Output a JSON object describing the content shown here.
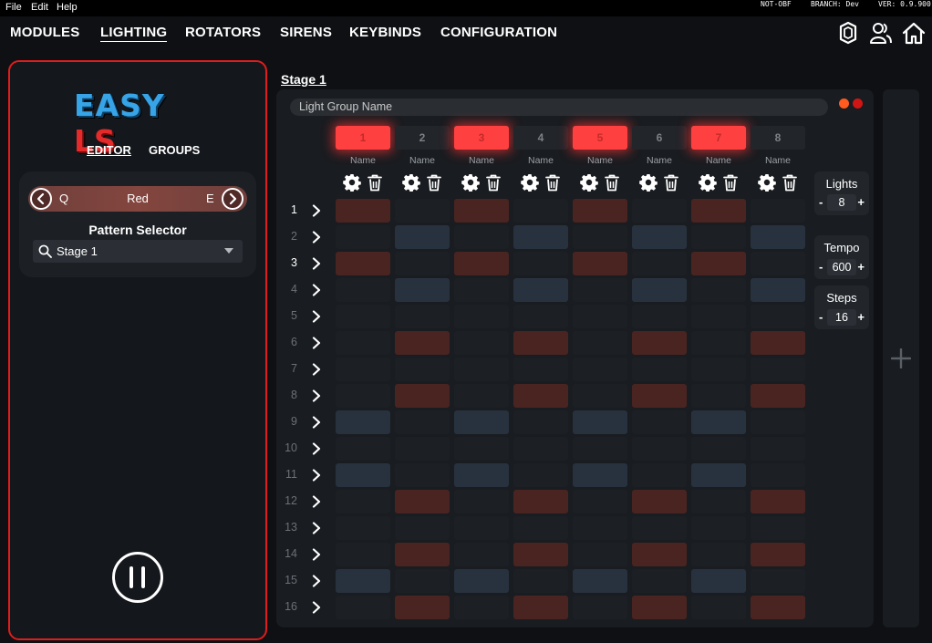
{
  "menu": {
    "file": "File",
    "edit": "Edit",
    "help": "Help"
  },
  "status": {
    "obf": "NOT-OBF",
    "branch": "BRANCH: Dev",
    "version": "VER: 0.9.900"
  },
  "nav": {
    "tabs": [
      "MODULES",
      "LIGHTING",
      "ROTATORS",
      "SIRENS",
      "KEYBINDS",
      "CONFIGURATION"
    ],
    "active": "LIGHTING",
    "icons": [
      "shield-icon",
      "users-icon",
      "home-icon"
    ]
  },
  "left": {
    "logo_easy": "EASY",
    "logo_ls": "LS",
    "subtabs": {
      "editor": "EDITOR",
      "groups": "GROUPS"
    },
    "color": {
      "prev_key": "Q",
      "name": "Red",
      "next_key": "E"
    },
    "pattern_selector_label": "Pattern Selector",
    "pattern_selected": "Stage 1"
  },
  "stage_title": "Stage 1",
  "grid": {
    "group_name_placeholder": "Light Group Name",
    "lights": [
      {
        "num": "1",
        "name": "Name",
        "on": true
      },
      {
        "num": "2",
        "name": "Name",
        "on": false
      },
      {
        "num": "3",
        "name": "Name",
        "on": true
      },
      {
        "num": "4",
        "name": "Name",
        "on": false
      },
      {
        "num": "5",
        "name": "Name",
        "on": true
      },
      {
        "num": "6",
        "name": "Name",
        "on": false
      },
      {
        "num": "7",
        "name": "Name",
        "on": true
      },
      {
        "num": "8",
        "name": "Name",
        "on": false
      }
    ],
    "row_labels": [
      "1",
      "2",
      "3",
      "4",
      "5",
      "6",
      "7",
      "8",
      "9",
      "10",
      "11",
      "12",
      "13",
      "14",
      "15",
      "16"
    ],
    "pattern": [
      "r.r.r.r.",
      ".b.b.b.b",
      "r.r.r.r.",
      ".b.b.b.b",
      "........",
      ".r.r.r.r",
      "........",
      ".r.r.r.r",
      "b.b.b.b.",
      "........",
      "b.b.b.b.",
      ".r.r.r.r",
      "........",
      ".r.r.r.r",
      "b.b.b.b.",
      ".r.r.r.r"
    ]
  },
  "controls": {
    "lights": {
      "label": "Lights",
      "value": "8"
    },
    "tempo": {
      "label": "Tempo",
      "value": "600"
    },
    "steps": {
      "label": "Steps",
      "value": "16"
    },
    "minus": "-",
    "plus": "+"
  },
  "colors": {
    "accent_red": "#e01c1c",
    "cell_red": "#4a2421",
    "cell_blue": "#28323e",
    "light_on": "#ff4040"
  }
}
